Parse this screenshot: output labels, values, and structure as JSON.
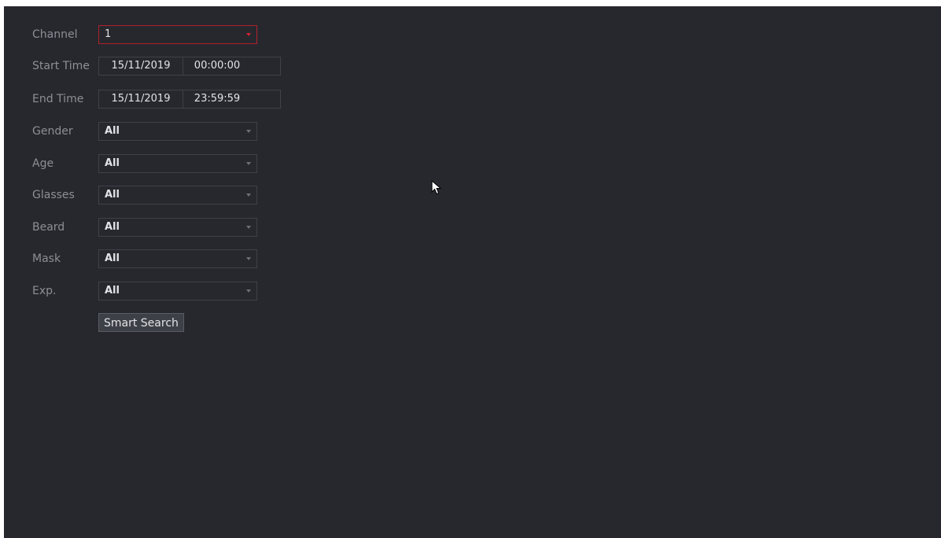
{
  "form": {
    "channel": {
      "label": "Channel",
      "value": "1"
    },
    "start_time": {
      "label": "Start Time",
      "date": "15/11/2019",
      "time": "00:00:00"
    },
    "end_time": {
      "label": "End Time",
      "date": "15/11/2019",
      "time": "23:59:59"
    },
    "gender": {
      "label": "Gender",
      "value": "All"
    },
    "age": {
      "label": "Age",
      "value": "All"
    },
    "glasses": {
      "label": "Glasses",
      "value": "All"
    },
    "beard": {
      "label": "Beard",
      "value": "All"
    },
    "mask": {
      "label": "Mask",
      "value": "All"
    },
    "expression": {
      "label": "Exp.",
      "value": "All"
    }
  },
  "actions": {
    "smart_search_label": "Smart Search"
  },
  "colors": {
    "background": "#27282e",
    "active_border": "#b0202b",
    "label_text": "#8d8f96",
    "value_text": "#e2e3e6"
  },
  "icons": {
    "dropdown": "chevron-down-icon",
    "pointer": "mouse-cursor-icon"
  }
}
